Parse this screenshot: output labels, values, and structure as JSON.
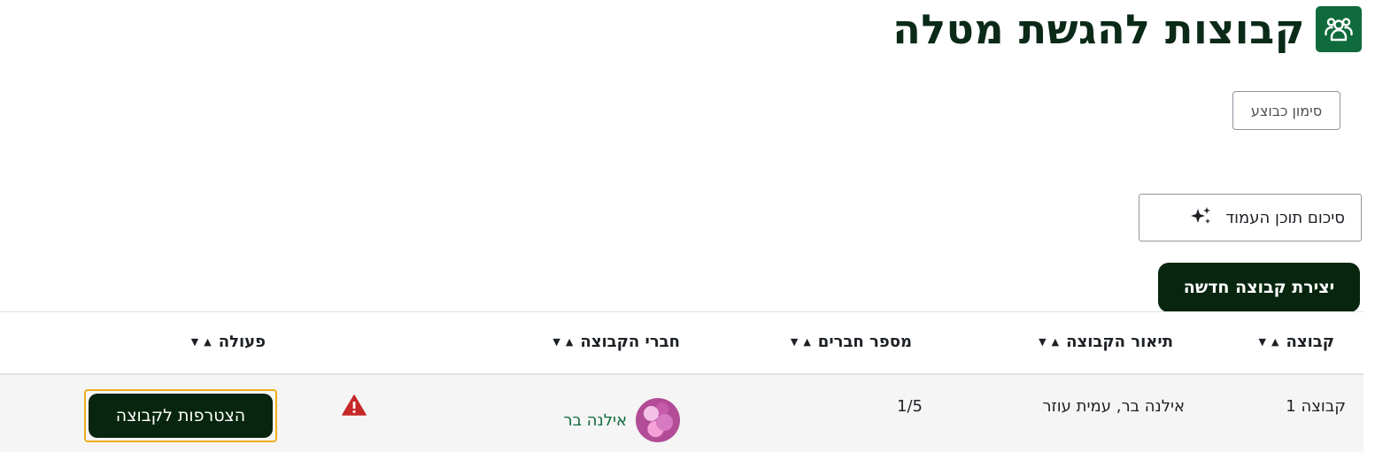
{
  "page": {
    "title": "קבוצות להגשת מטלה",
    "title_icon": "users-group-icon",
    "accent_color": "#0f6b3b"
  },
  "actions": {
    "mark_done_label": "סימון כבוצע",
    "summarize_label": "סיכום תוכן העמוד",
    "summarize_icon": "sparkles-icon",
    "create_group_label": "יצירת קבוצה חדשה"
  },
  "table": {
    "columns": [
      {
        "label": "קבוצה"
      },
      {
        "label": "תיאור הקבוצה"
      },
      {
        "label": "מספר חברים"
      },
      {
        "label": "חברי הקבוצה"
      },
      {
        "label": "פעולה"
      }
    ],
    "sort_asc_glyph": "▲",
    "sort_desc_glyph": "▼",
    "rows": [
      {
        "group": "קבוצה 1",
        "description": "אילנה בר, עמית עוזר",
        "member_count": "1/5",
        "member_name": "אילנה בר",
        "warning_icon": "warning-triangle-icon",
        "action_label": "הצטרפות לקבוצה"
      }
    ]
  }
}
